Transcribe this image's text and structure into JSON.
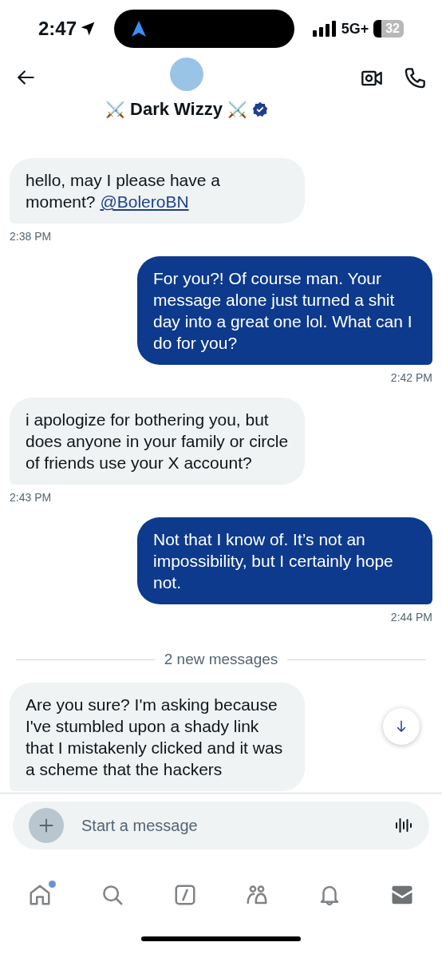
{
  "status_bar": {
    "time": "2:47",
    "network": "5G+",
    "battery": "32"
  },
  "header": {
    "name_prefix": "⚔️",
    "name": "Dark Wizzy",
    "name_suffix": "⚔️",
    "verified": true
  },
  "messages": [
    {
      "kind": "received",
      "text": "hello, may I please have a moment?",
      "link": "@BoleroBN",
      "time": "2:38 PM"
    },
    {
      "kind": "sent",
      "text": "For you?! Of course man. Your message alone just turned a shit day into a great one lol. What can I do for you?",
      "time": "2:42 PM"
    },
    {
      "kind": "received",
      "text": "i apologize for bothering you, but does anyone in your family or circle of friends use your X account?",
      "time": "2:43 PM"
    },
    {
      "kind": "sent",
      "text": "Not that I know of.  It’s not an impossibility, but I certainly hope not.",
      "time": "2:44 PM"
    },
    {
      "kind": "divider",
      "text": "2 new messages"
    },
    {
      "kind": "received",
      "text": "Are you sure? I'm asking because I've stumbled upon a shady link that I mistakenly clicked and it was a scheme that the hackers"
    }
  ],
  "composer": {
    "placeholder": "Start a message"
  },
  "nav": [
    {
      "kind": "home",
      "selected": false,
      "badge": true
    },
    {
      "kind": "search",
      "selected": false,
      "badge": false
    },
    {
      "kind": "grok",
      "selected": false,
      "badge": false
    },
    {
      "kind": "communities",
      "selected": false,
      "badge": false
    },
    {
      "kind": "notifications",
      "selected": false,
      "badge": false
    },
    {
      "kind": "messages",
      "selected": true,
      "badge": false
    }
  ]
}
